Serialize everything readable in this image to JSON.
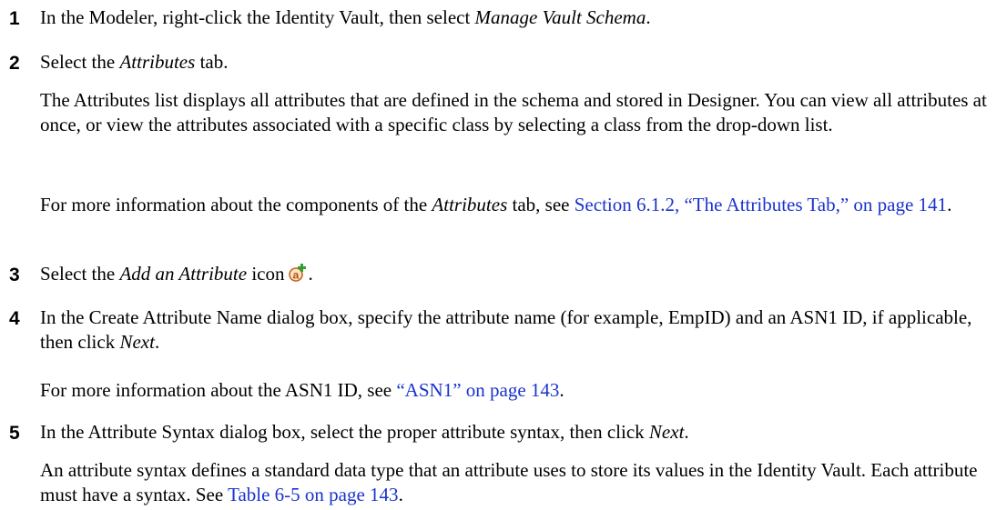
{
  "steps": [
    {
      "num": "1",
      "pre": "In the Modeler, right-click the Identity Vault, then select ",
      "em": "Manage Vault Schema",
      "post": "."
    },
    {
      "num": "2",
      "pre": "Select the ",
      "em": "Attributes",
      "post": " tab.",
      "para1": "The Attributes list displays all attributes that are defined in the schema and stored in Designer. You can view all attributes at once, or view the attributes associated with a specific class by selecting a class from the drop-down list.",
      "para2_pre": "For more information about the components of the ",
      "para2_em": "Attributes",
      "para2_mid": " tab, see ",
      "para2_link": "Section 6.1.2, “The Attributes Tab,” on page 141",
      "para2_post": "."
    },
    {
      "num": "3",
      "pre": "Select the ",
      "em": "Add an Attribute",
      "post": " icon",
      "icon": "add-attribute-icon",
      "end": "."
    },
    {
      "num": "4",
      "pre": "In the Create Attribute Name dialog box, specify the attribute name (for example, EmpID) and an ASN1 ID, if applicable, then click ",
      "em": "Next",
      "post": ".",
      "para1_pre": "For more information about the ASN1 ID, see ",
      "para1_link": "“ASN1” on page 143",
      "para1_post": "."
    },
    {
      "num": "5",
      "pre": "In the Attribute Syntax dialog box, select the proper attribute syntax, then click ",
      "em": "Next",
      "post": ".",
      "para1_pre": "An attribute syntax defines a standard data type that an attribute uses to store its values in the Identity Vault. Each attribute must have a syntax. See ",
      "para1_link": "Table 6-5 on page 143",
      "para1_post": "."
    }
  ]
}
